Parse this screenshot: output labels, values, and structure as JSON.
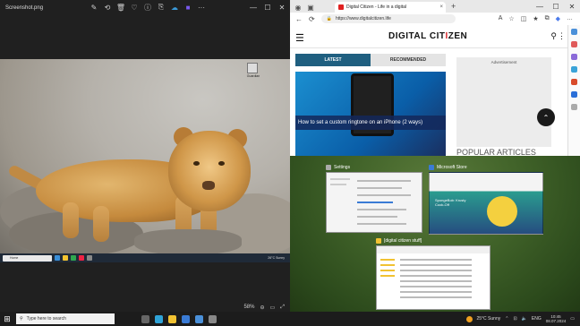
{
  "photos": {
    "filename": "Screenshot.png",
    "tools": [
      "edit-icon",
      "rotate-icon",
      "delete-icon",
      "favorite-icon",
      "info-icon",
      "share-icon",
      "onedrive-icon",
      "more-icon"
    ],
    "more_label": "···",
    "zoom": "58%",
    "mini_taskbar": {
      "search": "Home",
      "tray": "26°C  Sunny"
    },
    "desk_icon_label": "Guardian"
  },
  "edge": {
    "tab_title": "Digital Citizen - Life in a digital",
    "address": "https://www.digitalcitizen.life",
    "site": {
      "logo_left": "DIGITAL CIT",
      "logo_accent": "I",
      "logo_right": "ZEN",
      "tab_latest": "LATEST",
      "tab_recommended": "RECOMMENDED",
      "article_caption": "How to set a custom ringtone on an iPhone (2 ways)",
      "ad_label": "Advertisement",
      "popular": "POPULAR ARTICLES"
    }
  },
  "snap": {
    "settings": "Settings",
    "store": "Microsoft Store",
    "explorer": "[digital citizen stuff]",
    "store_banner": "SpongeBob: Krusty Cook-Off"
  },
  "taskbar": {
    "search_placeholder": "Type here to search",
    "weather": "25°C  Sunny",
    "lang": "ENG",
    "time": "10:45",
    "date": "08.07.2024"
  }
}
